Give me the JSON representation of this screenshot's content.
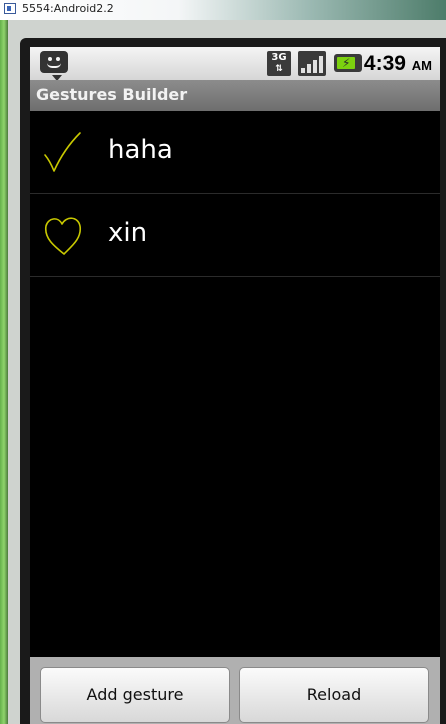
{
  "window": {
    "title": "5554:Android2.2"
  },
  "status_bar": {
    "network": "3G",
    "network_arrows": "⇅",
    "signal_level": 1.0,
    "battery_level": 0.8,
    "time": "4:39",
    "ampm": "AM"
  },
  "app": {
    "title": "Gestures Builder"
  },
  "gestures": [
    {
      "name": "haha",
      "icon": "checkmark-gesture-icon"
    },
    {
      "name": "xin",
      "icon": "heart-gesture-icon"
    }
  ],
  "buttons": {
    "add_label": "Add gesture",
    "reload_label": "Reload"
  },
  "colors": {
    "gesture_stroke": "#c8c800",
    "battery": "#7cd10f"
  }
}
